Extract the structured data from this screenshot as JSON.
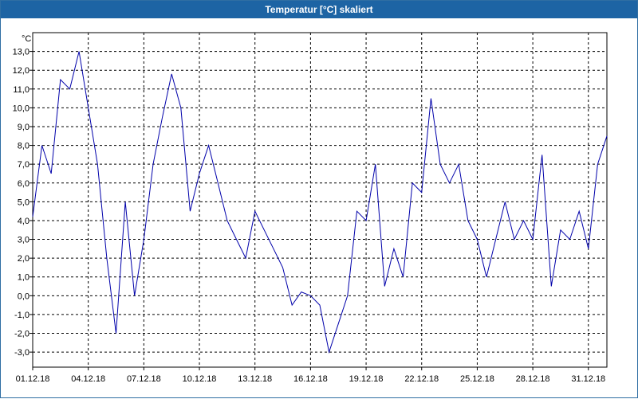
{
  "window": {
    "title": "Temperatur [°C] skaliert"
  },
  "colors": {
    "titlebar": "#1d64a4",
    "line": "#0000aa",
    "grid": "#000000"
  },
  "chart_data": {
    "type": "line",
    "title": "Temperatur [°C] skaliert",
    "ylabel": "°C",
    "ylim": [
      -3.8,
      14.0
    ],
    "xlim": [
      "2018-12-01",
      "2019-01-01"
    ],
    "y_ticks": [
      "13,0",
      "12,0",
      "11,0",
      "10,0",
      "9,0",
      "8,0",
      "7,0",
      "6,0",
      "5,0",
      "4,0",
      "3,0",
      "2,0",
      "1,0",
      "0,0",
      "-1,0",
      "-2,0",
      "-3,0"
    ],
    "x_ticks": [
      "01.12.18",
      "04.12.18",
      "07.12.18",
      "10.12.18",
      "13.12.18",
      "16.12.18",
      "19.12.18",
      "22.12.18",
      "25.12.18",
      "28.12.18",
      "31.12.18"
    ],
    "grid": true,
    "series": [
      {
        "x": [
          "2018-12-01",
          "2018-12-01 12:00",
          "2018-12-02",
          "2018-12-02 12:00",
          "2018-12-03",
          "2018-12-03 12:00",
          "2018-12-04",
          "2018-12-04 12:00",
          "2018-12-05",
          "2018-12-05 12:00",
          "2018-12-06",
          "2018-12-06 12:00",
          "2018-12-07",
          "2018-12-07 12:00",
          "2018-12-08",
          "2018-12-08 12:00",
          "2018-12-09",
          "2018-12-09 12:00",
          "2018-12-10",
          "2018-12-10 12:00",
          "2018-12-11",
          "2018-12-11 12:00",
          "2018-12-12",
          "2018-12-12 12:00",
          "2018-12-13",
          "2018-12-13 12:00",
          "2018-12-14",
          "2018-12-14 12:00",
          "2018-12-15",
          "2018-12-15 12:00",
          "2018-12-16",
          "2018-12-16 12:00",
          "2018-12-17",
          "2018-12-17 12:00",
          "2018-12-18",
          "2018-12-18 12:00",
          "2018-12-19",
          "2018-12-19 12:00",
          "2018-12-20",
          "2018-12-20 12:00",
          "2018-12-21",
          "2018-12-21 12:00",
          "2018-12-22",
          "2018-12-22 12:00",
          "2018-12-23",
          "2018-12-23 12:00",
          "2018-12-24",
          "2018-12-24 12:00",
          "2018-12-25",
          "2018-12-25 12:00",
          "2018-12-26",
          "2018-12-26 12:00",
          "2018-12-27",
          "2018-12-27 12:00",
          "2018-12-28",
          "2018-12-28 12:00",
          "2018-12-29",
          "2018-12-29 12:00",
          "2018-12-30",
          "2018-12-30 12:00",
          "2018-12-31",
          "2018-12-31 12:00",
          "2019-01-01"
        ],
        "y": [
          4.2,
          8.0,
          6.5,
          11.5,
          11.0,
          13.0,
          10.0,
          7.0,
          2.0,
          -2.0,
          5.0,
          0.0,
          3.0,
          7.0,
          9.5,
          11.8,
          10.0,
          4.5,
          6.5,
          8.0,
          6.0,
          4.0,
          3.0,
          2.0,
          4.5,
          3.5,
          2.5,
          1.5,
          -0.5,
          0.2,
          0.0,
          -0.5,
          -3.0,
          -1.5,
          0.0,
          4.5,
          4.0,
          7.0,
          0.5,
          2.5,
          1.0,
          6.0,
          5.5,
          10.5,
          7.0,
          6.0,
          7.0,
          4.0,
          3.0,
          1.0,
          3.0,
          5.0,
          3.0,
          4.0,
          3.0,
          7.5,
          0.5,
          3.5,
          3.0,
          4.5,
          2.5,
          7.0,
          8.5
        ]
      }
    ]
  }
}
